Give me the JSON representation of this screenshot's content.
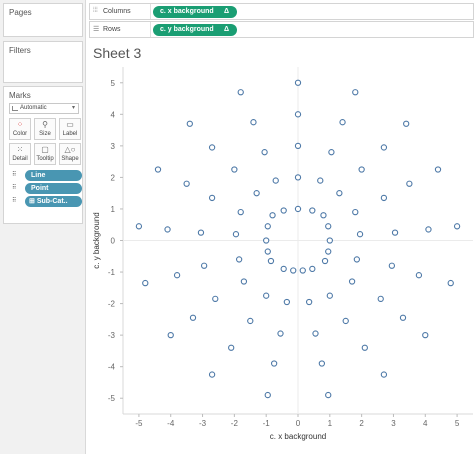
{
  "panels": {
    "pages": "Pages",
    "filters": "Filters",
    "marks": "Marks"
  },
  "marks_card": {
    "mark_type": "Automatic",
    "buttons": [
      {
        "name": "color",
        "label": "Color",
        "icon": "color-dots-icon"
      },
      {
        "name": "size",
        "label": "Size",
        "icon": "size-icon"
      },
      {
        "name": "label",
        "label": "Label",
        "icon": "label-icon"
      },
      {
        "name": "detail",
        "label": "Detail",
        "icon": "detail-dots-icon"
      },
      {
        "name": "tooltip",
        "label": "Tooltip",
        "icon": "tooltip-icon"
      },
      {
        "name": "shape",
        "label": "Shape",
        "icon": "shape-icon"
      }
    ],
    "pills": [
      {
        "label": "Line"
      },
      {
        "label": "Point"
      },
      {
        "label": "Sub-Cat.."
      }
    ]
  },
  "shelves": {
    "columns": {
      "label": "Columns",
      "pill": "c. x background",
      "delta": "Δ"
    },
    "rows": {
      "label": "Rows",
      "pill": "c. y background",
      "delta": "Δ"
    }
  },
  "sheet": {
    "title": "Sheet 3"
  },
  "colors": {
    "pill_green": "#1a9e73",
    "pill_blue": "#4996b2",
    "marker": "#4e79a7"
  },
  "chart_data": {
    "type": "scatter",
    "xlabel": "c. x background",
    "ylabel": "c. y background",
    "xlim": [
      -5.5,
      5.5
    ],
    "ylim": [
      -5.5,
      5.5
    ],
    "xticks": [
      -5,
      -4,
      -3,
      -2,
      -1,
      0,
      1,
      2,
      3,
      4,
      5
    ],
    "yticks": [
      -5,
      -4,
      -3,
      -2,
      -1,
      0,
      1,
      2,
      3,
      4,
      5
    ],
    "grid": "light zero lines",
    "marker": "open circle",
    "points": [
      [
        0,
        5
      ],
      [
        1.8,
        4.7
      ],
      [
        -1.8,
        4.7
      ],
      [
        0,
        4
      ],
      [
        1.4,
        3.75
      ],
      [
        -1.4,
        3.75
      ],
      [
        3.4,
        3.7
      ],
      [
        -3.4,
        3.7
      ],
      [
        0,
        3
      ],
      [
        1.05,
        2.8
      ],
      [
        -1.05,
        2.8
      ],
      [
        2.7,
        2.95
      ],
      [
        -2.7,
        2.95
      ],
      [
        4.4,
        2.25
      ],
      [
        -4.4,
        2.25
      ],
      [
        2.0,
        2.25
      ],
      [
        -2.0,
        2.25
      ],
      [
        0,
        2
      ],
      [
        0.7,
        1.9
      ],
      [
        -0.7,
        1.9
      ],
      [
        3.5,
        1.8
      ],
      [
        -3.5,
        1.8
      ],
      [
        1.3,
        1.5
      ],
      [
        -1.3,
        1.5
      ],
      [
        2.7,
        1.35
      ],
      [
        -2.7,
        1.35
      ],
      [
        0,
        1
      ],
      [
        0.45,
        0.95
      ],
      [
        -0.45,
        0.95
      ],
      [
        0.8,
        0.8
      ],
      [
        -0.8,
        0.8
      ],
      [
        1.8,
        0.9
      ],
      [
        -1.8,
        0.9
      ],
      [
        0.95,
        0.45
      ],
      [
        -0.95,
        0.45
      ],
      [
        5,
        0.45
      ],
      [
        -5,
        0.45
      ],
      [
        4.1,
        0.35
      ],
      [
        -4.1,
        0.35
      ],
      [
        3.05,
        0.25
      ],
      [
        -3.05,
        0.25
      ],
      [
        1.95,
        0.2
      ],
      [
        -1.95,
        0.2
      ],
      [
        1,
        0
      ],
      [
        -1,
        0
      ],
      [
        0.95,
        -0.35
      ],
      [
        -0.95,
        -0.35
      ],
      [
        1.85,
        -0.6
      ],
      [
        -1.85,
        -0.6
      ],
      [
        0.85,
        -0.65
      ],
      [
        -0.85,
        -0.65
      ],
      [
        2.95,
        -0.8
      ],
      [
        -2.95,
        -0.8
      ],
      [
        0.45,
        -0.9
      ],
      [
        -0.45,
        -0.9
      ],
      [
        0.15,
        -0.95
      ],
      [
        -0.15,
        -0.95
      ],
      [
        3.8,
        -1.1
      ],
      [
        -3.8,
        -1.1
      ],
      [
        1.7,
        -1.3
      ],
      [
        -1.7,
        -1.3
      ],
      [
        4.8,
        -1.35
      ],
      [
        -4.8,
        -1.35
      ],
      [
        0.35,
        -1.95
      ],
      [
        -0.35,
        -1.95
      ],
      [
        1.0,
        -1.75
      ],
      [
        -1.0,
        -1.75
      ],
      [
        2.6,
        -1.85
      ],
      [
        -2.6,
        -1.85
      ],
      [
        3.3,
        -2.45
      ],
      [
        -3.3,
        -2.45
      ],
      [
        1.5,
        -2.55
      ],
      [
        -1.5,
        -2.55
      ],
      [
        0.55,
        -2.95
      ],
      [
        -0.55,
        -2.95
      ],
      [
        4.0,
        -3.0
      ],
      [
        -4.0,
        -3.0
      ],
      [
        2.1,
        -3.4
      ],
      [
        -2.1,
        -3.4
      ],
      [
        0.75,
        -3.9
      ],
      [
        -0.75,
        -3.9
      ],
      [
        2.7,
        -4.25
      ],
      [
        -2.7,
        -4.25
      ],
      [
        0.95,
        -4.9
      ],
      [
        -0.95,
        -4.9
      ]
    ]
  }
}
